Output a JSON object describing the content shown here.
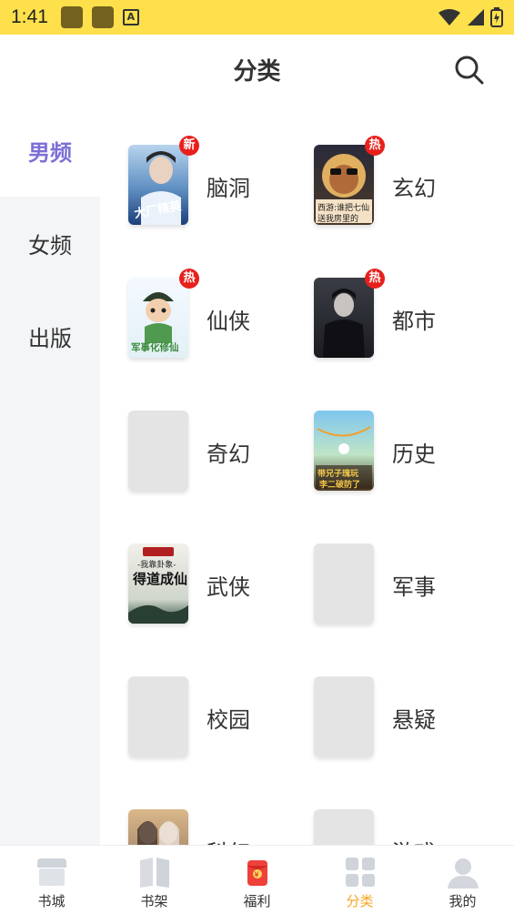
{
  "status_bar": {
    "time": "1:41"
  },
  "header": {
    "title": "分类"
  },
  "sidebar": {
    "items": [
      {
        "label": "男频",
        "active": true
      },
      {
        "label": "女频",
        "active": false
      },
      {
        "label": "出版",
        "active": false
      }
    ]
  },
  "categories": [
    {
      "name": "脑洞",
      "badge": "新",
      "cover": "cover-naodong"
    },
    {
      "name": "玄幻",
      "badge": "热",
      "cover": "cover-xuanhuan"
    },
    {
      "name": "仙侠",
      "badge": "热",
      "cover": "cover-xianxia"
    },
    {
      "name": "都市",
      "badge": "热",
      "cover": "cover-dushi"
    },
    {
      "name": "奇幻",
      "badge": "",
      "cover": "placeholder"
    },
    {
      "name": "历史",
      "badge": "",
      "cover": "cover-lishi"
    },
    {
      "name": "武侠",
      "badge": "",
      "cover": "cover-wuxia"
    },
    {
      "name": "军事",
      "badge": "",
      "cover": "placeholder"
    },
    {
      "name": "校园",
      "badge": "",
      "cover": "placeholder"
    },
    {
      "name": "悬疑",
      "badge": "",
      "cover": "placeholder"
    },
    {
      "name": "科幻",
      "badge": "",
      "cover": "cover-kehuan"
    },
    {
      "name": "游戏",
      "badge": "",
      "cover": "placeholder"
    }
  ],
  "tabbar": {
    "items": [
      {
        "label": "书城",
        "icon": "bookstore-icon",
        "active": false
      },
      {
        "label": "书架",
        "icon": "bookshelf-icon",
        "active": false
      },
      {
        "label": "福利",
        "icon": "red-envelope-icon",
        "active": false
      },
      {
        "label": "分类",
        "icon": "category-grid-icon",
        "active": true
      },
      {
        "label": "我的",
        "icon": "profile-icon",
        "active": false
      }
    ]
  },
  "colors": {
    "status_bar": "#fde04b",
    "accent_sidebar": "#7b6fd6",
    "accent_tab": "#f5a623",
    "badge": "#e8201c"
  }
}
